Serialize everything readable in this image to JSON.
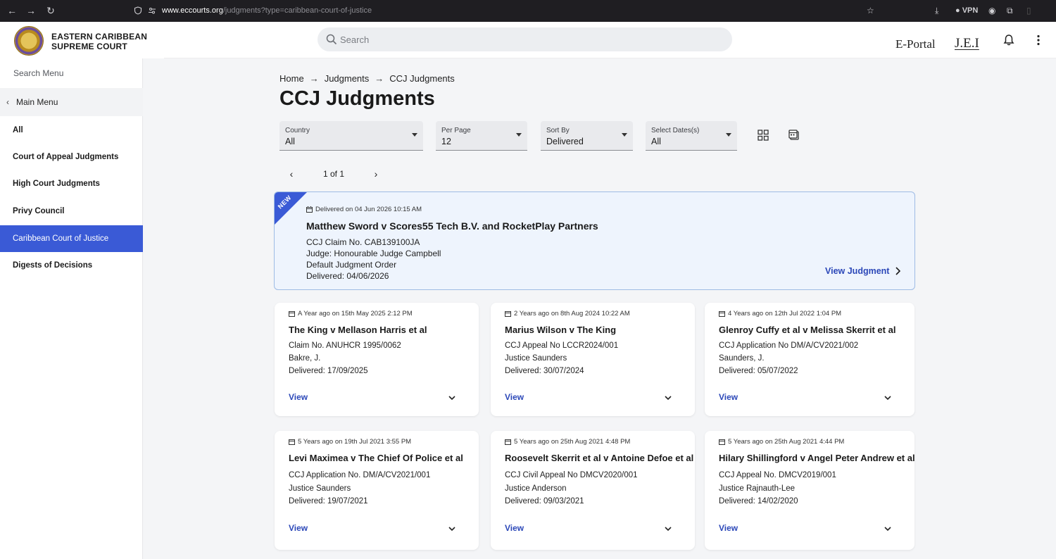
{
  "browser": {
    "url_host": "www.eccourts.org",
    "url_path": "/judgments?type=caribbean-court-of-justice",
    "vpn_label": "VPN"
  },
  "header": {
    "logo_line1": "EASTERN CARIBBEAN",
    "logo_line2": "SUPREME COURT",
    "search_placeholder": "Search",
    "eportal_label": "E-Portal",
    "jei_label": "J.E.I"
  },
  "sidebar": {
    "search_label": "Search Menu",
    "main_menu_label": "Main Menu",
    "items": [
      {
        "label": "All"
      },
      {
        "label": "Court of Appeal Judgments"
      },
      {
        "label": "High Court Judgments"
      },
      {
        "label": "Privy Council"
      },
      {
        "label": "Caribbean Court of Justice"
      },
      {
        "label": "Digests of Decisions"
      }
    ],
    "active_index": 4
  },
  "breadcrumb": [
    "Home",
    "Judgments",
    "CCJ Judgments"
  ],
  "breadcrumb_separator": "→",
  "page_title": "CCJ Judgments",
  "filters": [
    {
      "label": "Country",
      "value": "All"
    },
    {
      "label": "Per Page",
      "value": "12"
    },
    {
      "label": "Sort By",
      "value": "Delivered"
    },
    {
      "label": "Select Dates(s)",
      "value": "All"
    }
  ],
  "pagination": {
    "text": "1 of 1"
  },
  "featured": {
    "badge": "NEW",
    "date": "Delivered on 04 Jun 2026 10:15 AM",
    "title": "Matthew Sword v Scores55 Tech B.V. and RocketPlay Partners",
    "lines": [
      "CCJ Claim No. CAB139100JA",
      "Judge: Honourable Judge Campbell",
      "Default Judgment Order",
      "Delivered: 04/06/2026"
    ],
    "view_label": "View Judgment"
  },
  "cards": [
    {
      "date": "A Year ago on 15th May 2025 2:12 PM",
      "title": "The King v Mellason Harris et al",
      "lines": [
        "Claim No. ANUHCR 1995/0062",
        "Bakre, J.",
        "Delivered: 17/09/2025"
      ],
      "view_label": "View"
    },
    {
      "date": "2 Years ago on 8th Aug 2024 10:22 AM",
      "title": "Marius Wilson v The King",
      "lines": [
        "CCJ Appeal No LCCR2024/001",
        "Justice Saunders",
        "Delivered: 30/07/2024"
      ],
      "view_label": "View"
    },
    {
      "date": "4 Years ago on 12th Jul 2022 1:04 PM",
      "title": "Glenroy Cuffy et al v Melissa Skerrit et al",
      "lines": [
        "CCJ Application No DM/A/CV2021/002",
        "Saunders, J.",
        "Delivered: 05/07/2022"
      ],
      "view_label": "View"
    },
    {
      "date": "5 Years ago on 19th Jul 2021 3:55 PM",
      "title": "Levi Maximea v The Chief Of Police et al",
      "lines": [
        "CCJ Application No. DM/A/CV2021/001",
        "Justice Saunders",
        "Delivered: 19/07/2021"
      ],
      "view_label": "View"
    },
    {
      "date": "5 Years ago on 25th Aug 2021 4:48 PM",
      "title": "Roosevelt Skerrit et al v Antoine Defoe et al",
      "lines": [
        "CCJ Civil Appeal No DMCV2020/001",
        "Justice Anderson",
        "Delivered: 09/03/2021"
      ],
      "view_label": "View"
    },
    {
      "date": "5 Years ago on 25th Aug 2021 4:44 PM",
      "title": "Hilary Shillingford v Angel Peter Andrew et al",
      "lines": [
        "CCJ Appeal No. DMCV2019/001",
        "Justice Rajnauth-Lee",
        "Delivered: 14/02/2020"
      ],
      "view_label": "View"
    }
  ],
  "colors": {
    "accent": "#3a5ad6",
    "link": "#2b47b8",
    "featured_bg": "#eef4fd"
  }
}
